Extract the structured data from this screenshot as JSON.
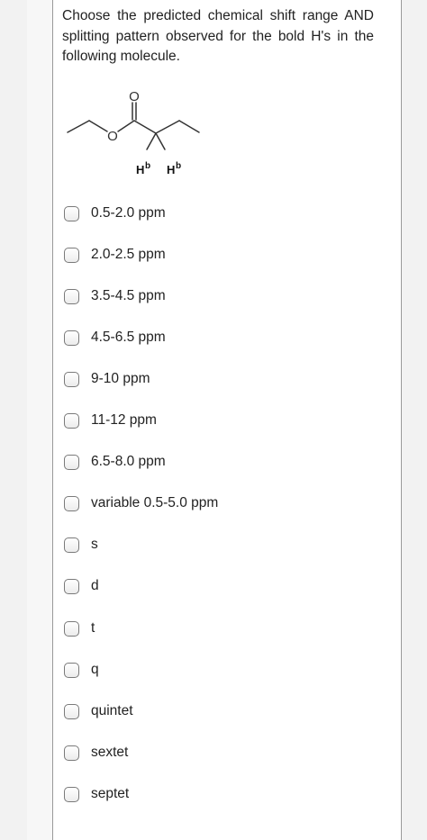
{
  "question": {
    "text": "Choose the predicted chemical shift range AND splitting pattern observed for the bold H's in the following molecule."
  },
  "molecule": {
    "oxygen_ester": "O",
    "oxygen_carbonyl": "O",
    "h_label": "H",
    "h_superscript": "b"
  },
  "options": [
    {
      "label": "0.5-2.0 ppm"
    },
    {
      "label": "2.0-2.5 ppm"
    },
    {
      "label": "3.5-4.5 ppm"
    },
    {
      "label": "4.5-6.5 ppm"
    },
    {
      "label": "9-10 ppm"
    },
    {
      "label": "11-12 ppm"
    },
    {
      "label": "6.5-8.0 ppm"
    },
    {
      "label": "variable 0.5-5.0 ppm"
    },
    {
      "label": "s"
    },
    {
      "label": "d"
    },
    {
      "label": "t"
    },
    {
      "label": "q"
    },
    {
      "label": "quintet"
    },
    {
      "label": "sextet"
    },
    {
      "label": "septet"
    }
  ]
}
